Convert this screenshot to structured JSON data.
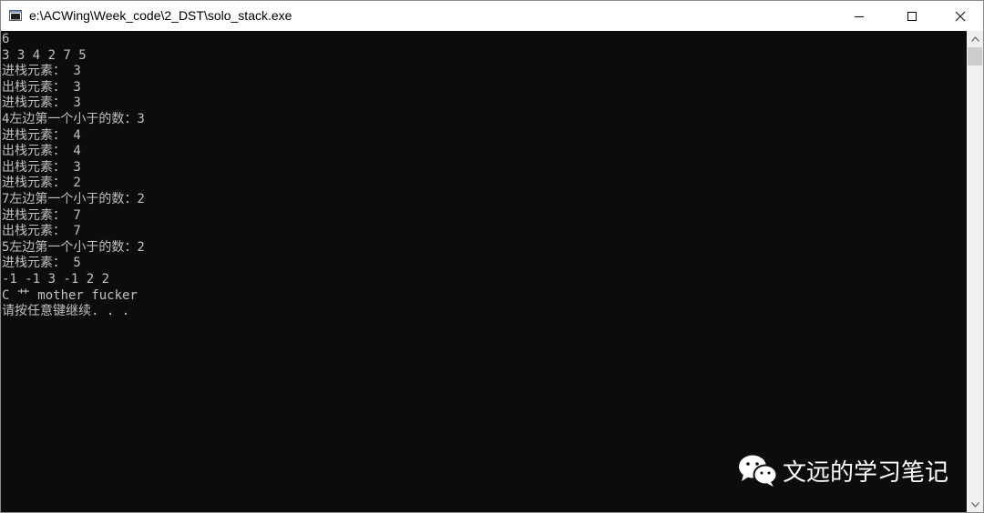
{
  "window": {
    "title": "e:\\ACWing\\Week_code\\2_DST\\solo_stack.exe"
  },
  "console": {
    "lines": [
      "6",
      "3 3 4 2 7 5",
      "进栈元素： 3",
      "出栈元素： 3",
      "进栈元素： 3",
      "4左边第一个小于的数：3",
      "进栈元素： 4",
      "出栈元素： 4",
      "出栈元素： 3",
      "进栈元素： 2",
      "7左边第一个小于的数：2",
      "进栈元素： 7",
      "出栈元素： 7",
      "5左边第一个小于的数：2",
      "进栈元素： 5",
      "-1 -1 3 -1 2 2",
      "C 艹 mother fucker",
      "请按任意键继续. . ."
    ]
  },
  "watermark": {
    "text": "文远的学习笔记",
    "icon": "wechat-icon"
  },
  "icons": {
    "app": "console-app-icon",
    "minimize": "minimize-icon",
    "maximize": "maximize-icon",
    "close": "close-icon"
  }
}
